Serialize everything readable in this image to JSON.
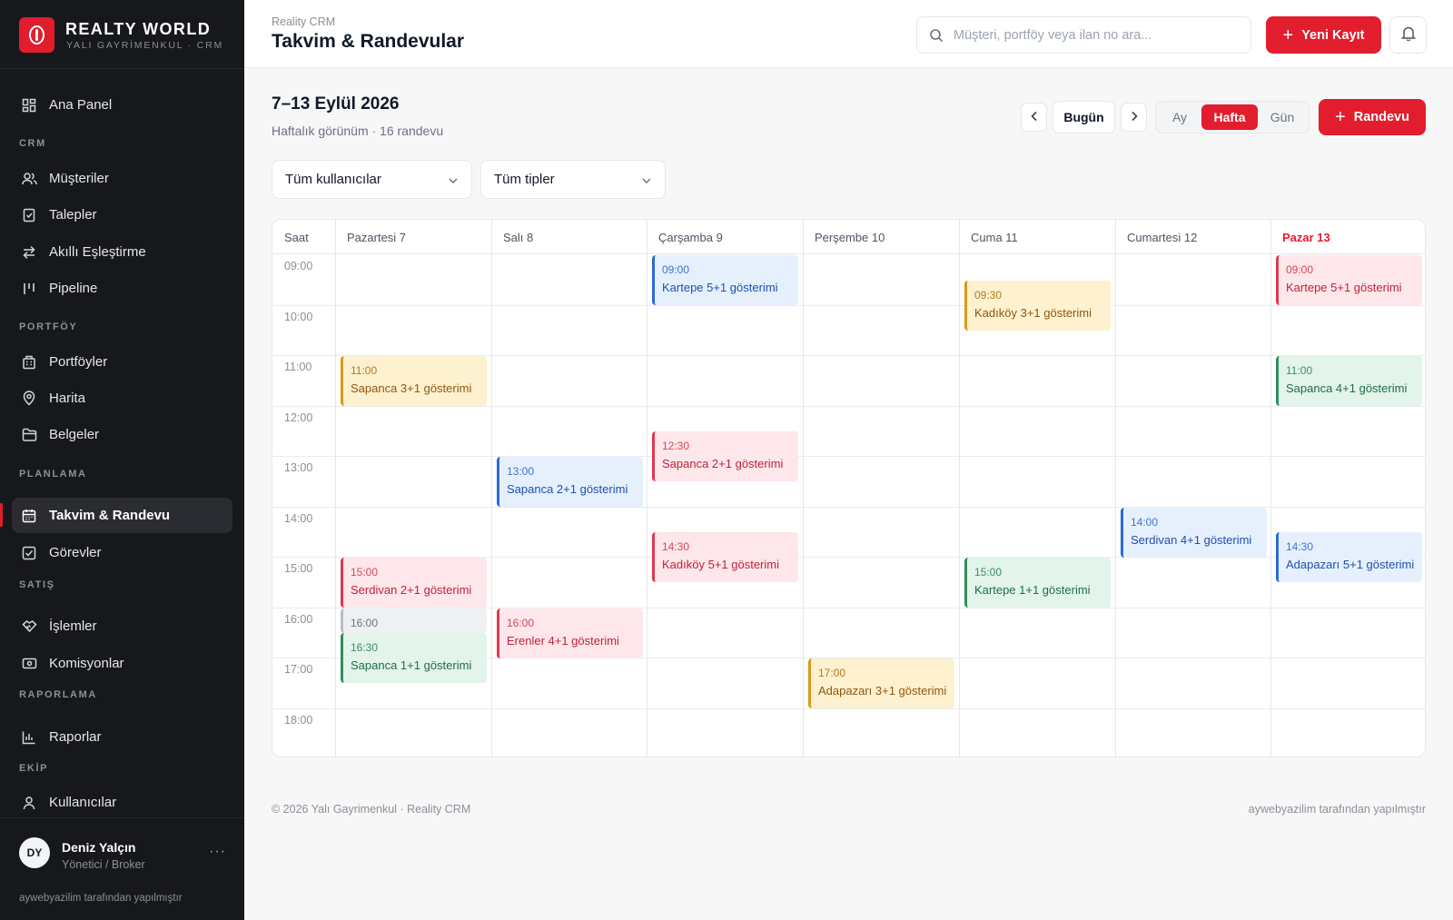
{
  "brand": {
    "name": "REALTY WORLD",
    "subtitle": "YALI GAYRİMENKUL · CRM"
  },
  "sidebar": {
    "home": {
      "label": "Ana Panel",
      "icon": "dashboard-icon"
    },
    "sections": [
      {
        "title": "CRM",
        "items": [
          {
            "label": "Müşteriler",
            "icon": "users-icon"
          },
          {
            "label": "Talepler",
            "icon": "request-icon"
          },
          {
            "label": "Akıllı Eşleştirme",
            "icon": "swap-icon"
          },
          {
            "label": "Pipeline",
            "icon": "pipeline-icon"
          }
        ]
      },
      {
        "title": "PORTFÖY",
        "items": [
          {
            "label": "Portföyler",
            "icon": "building-icon"
          },
          {
            "label": "Harita",
            "icon": "map-pin-icon"
          },
          {
            "label": "Belgeler",
            "icon": "folder-icon"
          }
        ]
      },
      {
        "title": "PLANLAMA",
        "items": [
          {
            "label": "Takvim & Randevu",
            "icon": "calendar-icon",
            "active": true
          },
          {
            "label": "Görevler",
            "icon": "checkbox-icon"
          }
        ]
      },
      {
        "title": "SATIŞ",
        "items": [
          {
            "label": "İşlemler",
            "icon": "handshake-icon"
          },
          {
            "label": "Komisyonlar",
            "icon": "money-icon"
          }
        ]
      },
      {
        "title": "RAPORLAMA",
        "items": [
          {
            "label": "Raporlar",
            "icon": "bar-chart-icon"
          }
        ]
      },
      {
        "title": "EKİP",
        "items": [
          {
            "label": "Kullanıcılar",
            "icon": "user-icon"
          }
        ]
      }
    ]
  },
  "user": {
    "initials": "DY",
    "name": "Deniz Yalçın",
    "role": "Yönetici / Broker",
    "more": "···"
  },
  "sidebar_credit": "aywebyazilim tarafından yapılmıştır",
  "header": {
    "breadcrumb": "Reality CRM",
    "title": "Takvim & Randevular",
    "search_placeholder": "Müşteri, portföy veya ilan no ara...",
    "new_record": "Yeni Kayıt"
  },
  "toolbar": {
    "range_title": "7–13 Eylül 2026",
    "range_sub": "Haftalık görünüm · 16 randevu",
    "prev": "‹",
    "today": "Bugün",
    "next": "›",
    "views": [
      "Ay",
      "Hafta",
      "Gün"
    ],
    "active_view": "Hafta",
    "add_appointment": "Randevu"
  },
  "filters": {
    "users": "Tüm kullanıcılar",
    "types": "Tüm tipler"
  },
  "calendar": {
    "time_header": "Saat",
    "days": [
      "Pazartesi 7",
      "Salı 8",
      "Çarşamba 9",
      "Perşembe 10",
      "Cuma 11",
      "Cumartesi 12",
      "Pazar 13"
    ],
    "today_index": 6,
    "hours": [
      "09:00",
      "10:00",
      "11:00",
      "12:00",
      "13:00",
      "14:00",
      "15:00",
      "16:00",
      "17:00",
      "18:00"
    ],
    "colors": {
      "blue": {
        "bg": "#e6f0fd",
        "border": "#2b6bd8",
        "time": "#3b74d6",
        "text": "#1d4fb0"
      },
      "yellow": {
        "bg": "#fdf1cf",
        "border": "#d99a16",
        "time": "#b7791f",
        "text": "#92560f"
      },
      "red": {
        "bg": "#fde7ea",
        "border": "#e0384f",
        "time": "#d6455a",
        "text": "#c1223a"
      },
      "green": {
        "bg": "#e3f4ea",
        "border": "#2f8f5b",
        "time": "#3b8f63",
        "text": "#1f6e45"
      },
      "gray": {
        "bg": "#eef0f2",
        "border": "#b9bec6",
        "time": "#6b7280",
        "text": "#374151"
      }
    },
    "events": [
      {
        "day": 0,
        "start": 11.0,
        "end": 12.0,
        "time": "11:00",
        "title": "Sapanca 3+1 gösterimi",
        "color": "yellow"
      },
      {
        "day": 0,
        "start": 15.0,
        "end": 16.0,
        "time": "15:00",
        "title": "Serdivan 2+1 gösterimi",
        "color": "red"
      },
      {
        "day": 0,
        "start": 16.0,
        "end": 16.5,
        "time": "16:00",
        "title": "",
        "color": "gray"
      },
      {
        "day": 0,
        "start": 16.5,
        "end": 17.5,
        "time": "16:30",
        "title": "Sapanca 1+1 gösterimi",
        "color": "green"
      },
      {
        "day": 1,
        "start": 13.0,
        "end": 14.0,
        "time": "13:00",
        "title": "Sapanca 2+1 gösterimi",
        "color": "blue"
      },
      {
        "day": 1,
        "start": 16.0,
        "end": 17.0,
        "time": "16:00",
        "title": "Erenler 4+1 gösterimi",
        "color": "red"
      },
      {
        "day": 2,
        "start": 9.0,
        "end": 10.0,
        "time": "09:00",
        "title": "Kartepe 5+1 gösterimi",
        "color": "blue"
      },
      {
        "day": 2,
        "start": 12.5,
        "end": 13.5,
        "time": "12:30",
        "title": "Sapanca 2+1 gösterimi",
        "color": "red"
      },
      {
        "day": 2,
        "start": 14.5,
        "end": 15.5,
        "time": "14:30",
        "title": "Kadıköy 5+1 gösterimi",
        "color": "red"
      },
      {
        "day": 3,
        "start": 17.0,
        "end": 18.0,
        "time": "17:00",
        "title": "Adapazarı 3+1 gösterimi",
        "color": "yellow"
      },
      {
        "day": 4,
        "start": 9.5,
        "end": 10.5,
        "time": "09:30",
        "title": "Kadıköy 3+1 gösterimi",
        "color": "yellow"
      },
      {
        "day": 4,
        "start": 15.0,
        "end": 16.0,
        "time": "15:00",
        "title": "Kartepe 1+1 gösterimi",
        "color": "green"
      },
      {
        "day": 5,
        "start": 14.0,
        "end": 15.0,
        "time": "14:00",
        "title": "Serdivan 4+1 gösterimi",
        "color": "blue"
      },
      {
        "day": 6,
        "start": 9.0,
        "end": 10.0,
        "time": "09:00",
        "title": "Kartepe 5+1 gösterimi",
        "color": "red"
      },
      {
        "day": 6,
        "start": 11.0,
        "end": 12.0,
        "time": "11:00",
        "title": "Sapanca 4+1 gösterimi",
        "color": "green"
      },
      {
        "day": 6,
        "start": 14.5,
        "end": 15.5,
        "time": "14:30",
        "title": "Adapazarı 5+1 gösterimi",
        "color": "blue"
      }
    ]
  },
  "footer": {
    "left": "© 2026 Yalı Gayrimenkul · Reality CRM",
    "right": "aywebyazilim tarafından yapılmıştır"
  },
  "accent": "#e11d2e"
}
